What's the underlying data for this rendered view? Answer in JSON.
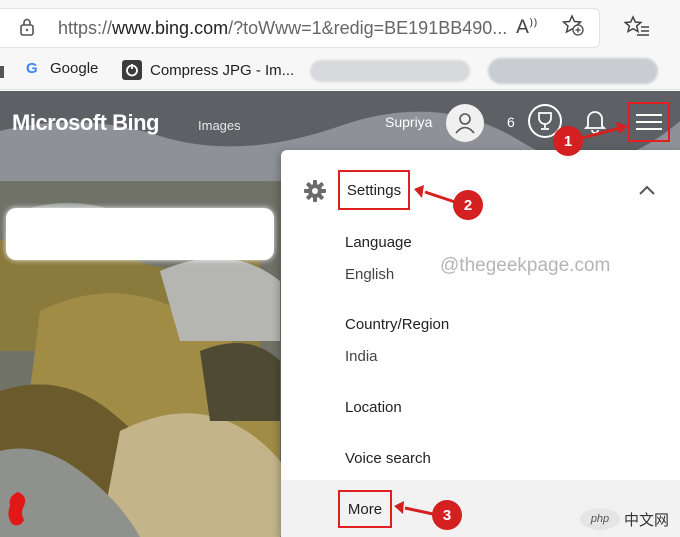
{
  "browser": {
    "url_prefix": "https://",
    "url_host": "www.bing.com",
    "url_rest": "/?toWww=1&redig=BE191BB490...",
    "read_aloud_icon": "read-aloud-icon",
    "add_favorite_icon": "add-favorite-icon",
    "favorites_icon": "favorites-icon"
  },
  "bookmarks": [
    {
      "label": "Google",
      "icon": "google-icon"
    },
    {
      "label": "Compress JPG - Im...",
      "icon": "compress-jpg-icon"
    }
  ],
  "bing": {
    "logo": "Microsoft Bing",
    "nav_images": "Images",
    "user_name": "Supriya",
    "points": "6"
  },
  "menu": {
    "settings_label": "Settings",
    "items": [
      {
        "label": "Language",
        "value": "English"
      },
      {
        "label": "Country/Region",
        "value": "India"
      },
      {
        "label": "Location"
      },
      {
        "label": "Voice search"
      }
    ],
    "more_label": "More"
  },
  "annotations": {
    "step1": "1",
    "step2": "2",
    "step3": "3",
    "highlight_color": "#e02020"
  },
  "watermark": "@thegeekpage.com",
  "corner_logo": {
    "badge": "php",
    "text": "中文网"
  }
}
